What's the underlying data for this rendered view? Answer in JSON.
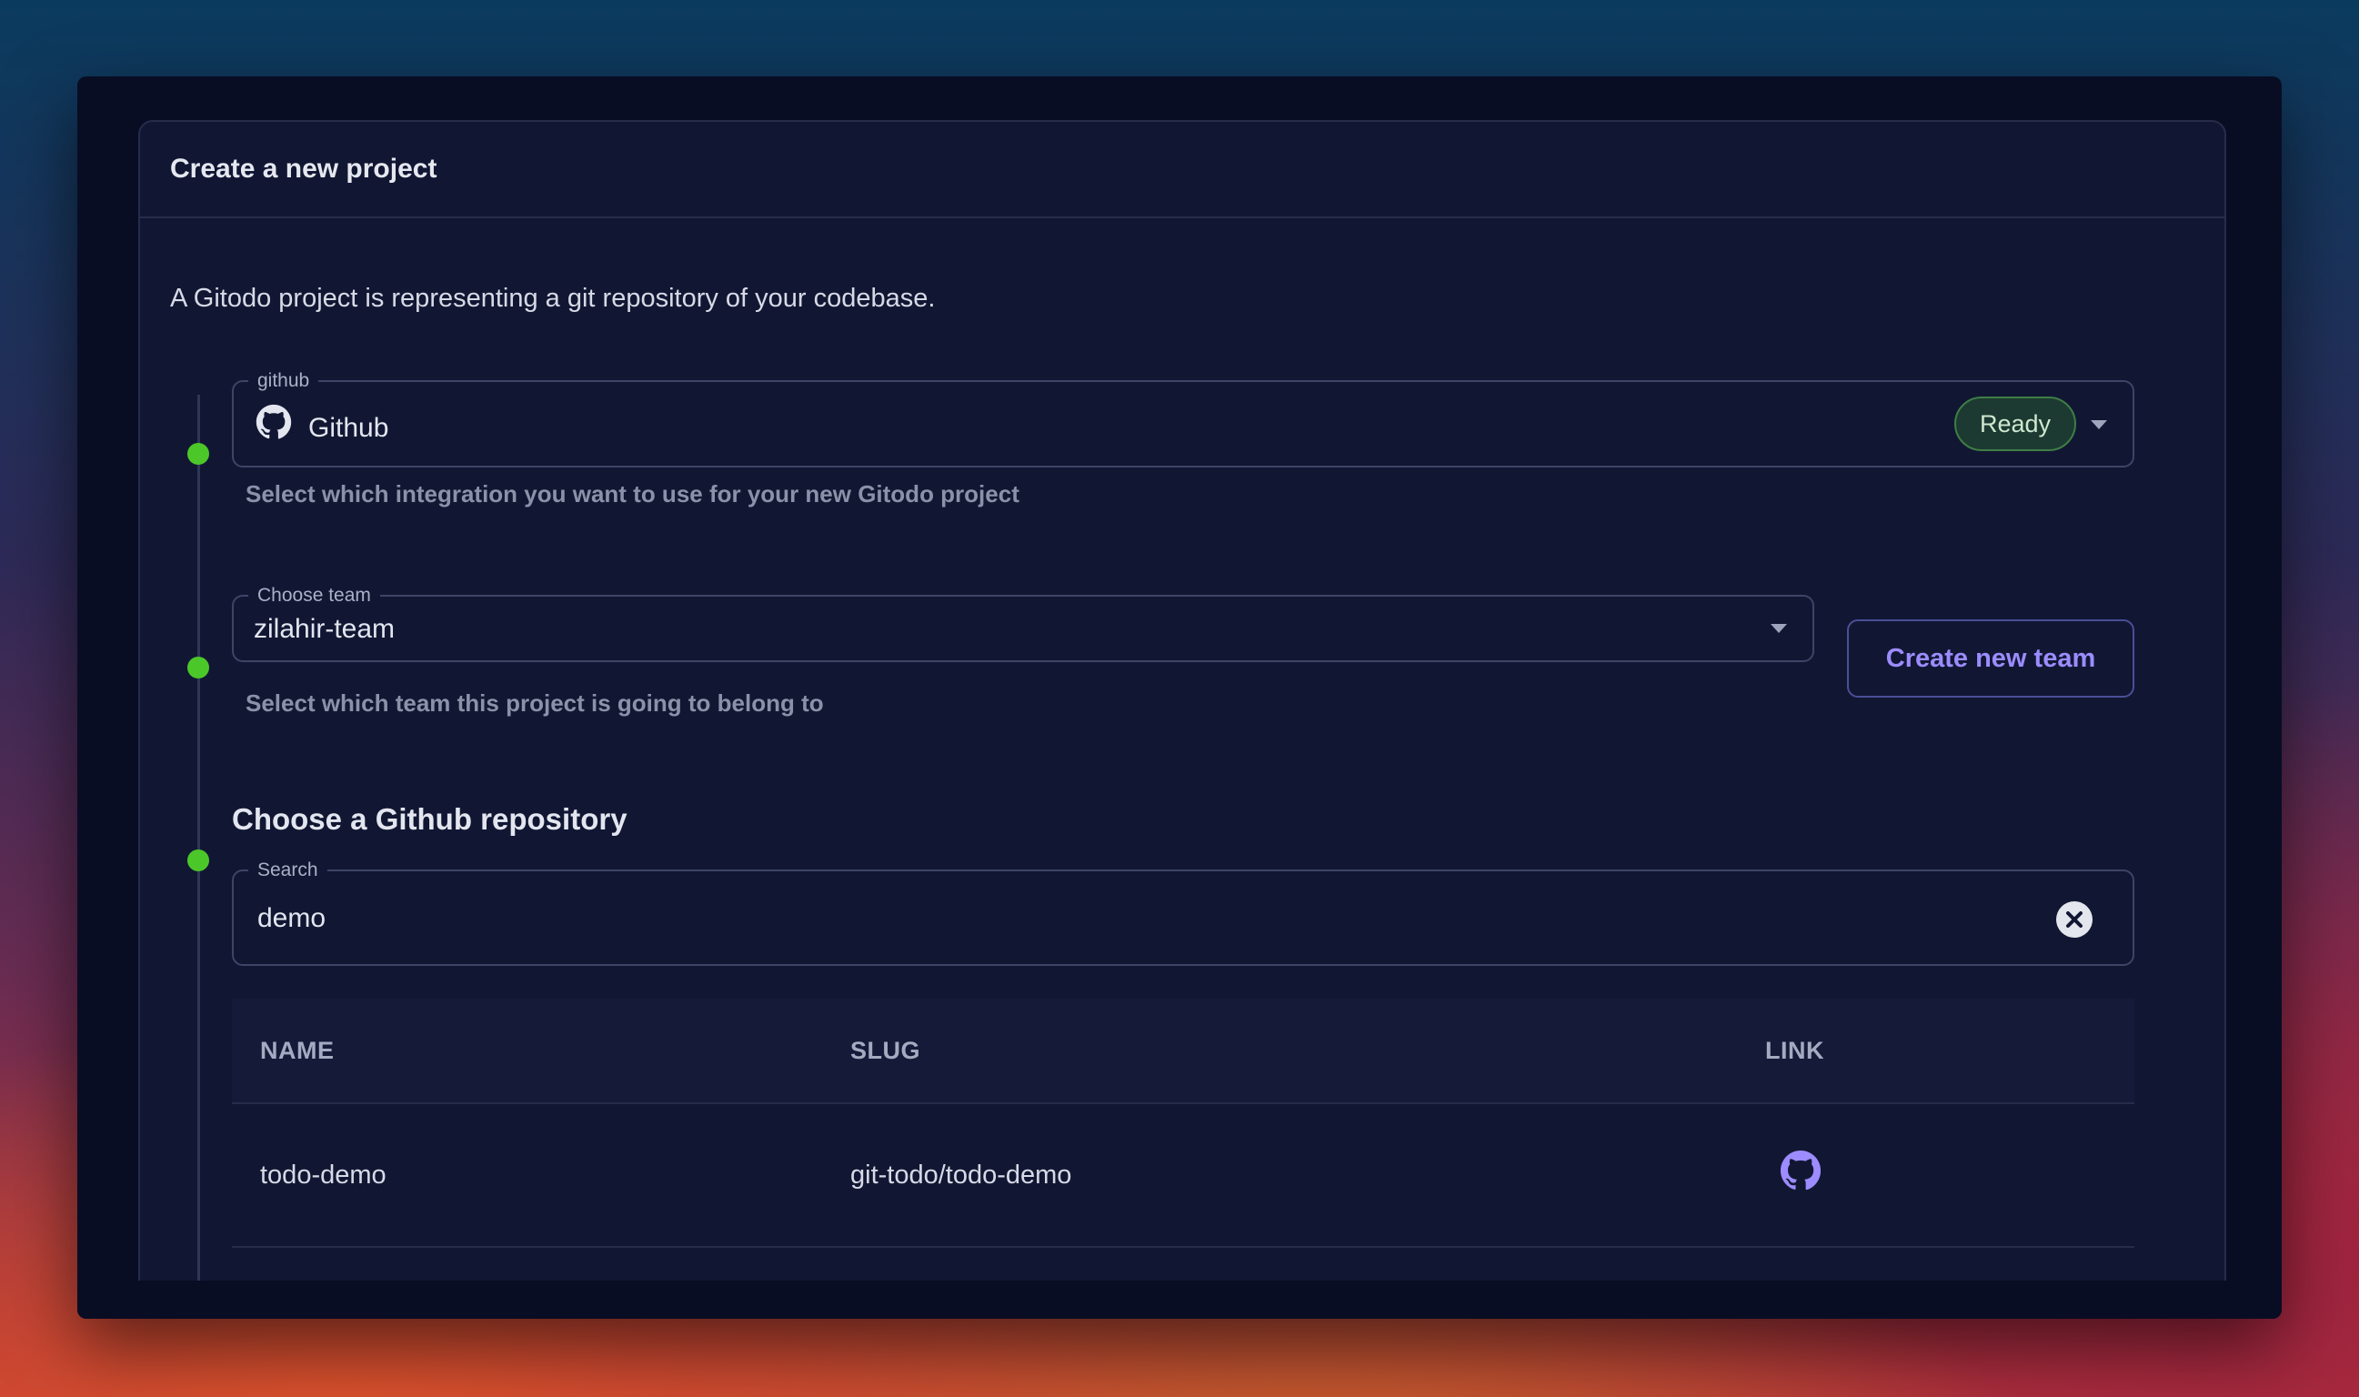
{
  "card": {
    "title": "Create a new project",
    "intro": "A Gitodo project is representing a git repository of your codebase."
  },
  "integration": {
    "legend": "github",
    "icon": "github-icon",
    "value": "Github",
    "status": "Ready",
    "helper": "Select which integration you want to use for your new Gitodo project"
  },
  "team": {
    "legend": "Choose team",
    "value": "zilahir-team",
    "helper": "Select which team this project is going to belong to",
    "create_label": "Create new team"
  },
  "repository": {
    "title": "Choose a Github repository",
    "search_legend": "Search",
    "search_value": "demo",
    "columns": [
      "NAME",
      "SLUG",
      "LINK"
    ],
    "rows": [
      {
        "name": "todo-demo",
        "slug": "git-todo/todo-demo",
        "link_icon": "github-icon"
      }
    ]
  },
  "colors": {
    "accent": "#9c8cff",
    "success_dot": "#4cc72a",
    "ready_badge_bg": "#1c3a31",
    "card_bg": "#111733"
  }
}
